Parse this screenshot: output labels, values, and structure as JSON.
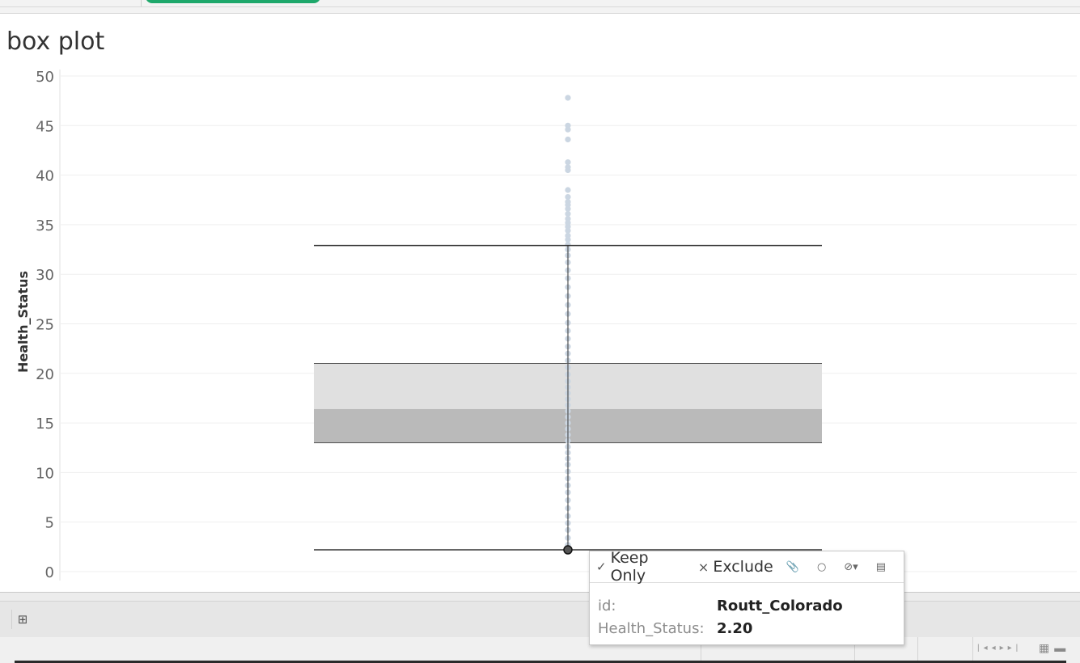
{
  "sheet": {
    "title": "box plot"
  },
  "chart_data": {
    "type": "box",
    "title": "",
    "ylabel": "Health_Status",
    "ylim": [
      0,
      50
    ],
    "yticks": [
      0,
      5,
      10,
      15,
      20,
      25,
      30,
      35,
      40,
      45,
      50
    ],
    "box": {
      "lower_whisker": 2.2,
      "q1": 13.0,
      "median": 16.4,
      "q3": 21.0,
      "upper_whisker": 32.9
    },
    "points": [
      47.8,
      45.0,
      44.6,
      43.6,
      41.3,
      40.8,
      40.5,
      38.5,
      37.8,
      37.3,
      37.0,
      36.6,
      36.1,
      35.6,
      35.2,
      34.8,
      34.4,
      33.9,
      33.5,
      33.0,
      32.5,
      31.9,
      31.2,
      30.4,
      29.6,
      28.7,
      27.8,
      26.9,
      26.0,
      25.1,
      24.3,
      23.5,
      22.7,
      22.0,
      21.3,
      20.6,
      19.9,
      19.2,
      18.6,
      18.0,
      17.4,
      16.8,
      16.2,
      15.6,
      15.0,
      14.4,
      13.8,
      13.2,
      12.6,
      12.0,
      11.4,
      10.8,
      10.1,
      9.4,
      8.7,
      8.0,
      7.2,
      6.4,
      5.6,
      4.9,
      4.2,
      3.4,
      2.7,
      2.2
    ],
    "highlighted_point": 2.2,
    "grid": true,
    "box_colors": {
      "upper": "#e0e0e0",
      "lower": "#bababa",
      "points": "#cbd6e2",
      "lines": "#333333"
    }
  },
  "tooltip": {
    "keep_only_label": "Keep Only",
    "exclude_label": "Exclude",
    "fields": [
      {
        "key": "id:",
        "value": "Routt_Colorado"
      },
      {
        "key": "Health_Status:",
        "value": "2.20"
      }
    ]
  }
}
